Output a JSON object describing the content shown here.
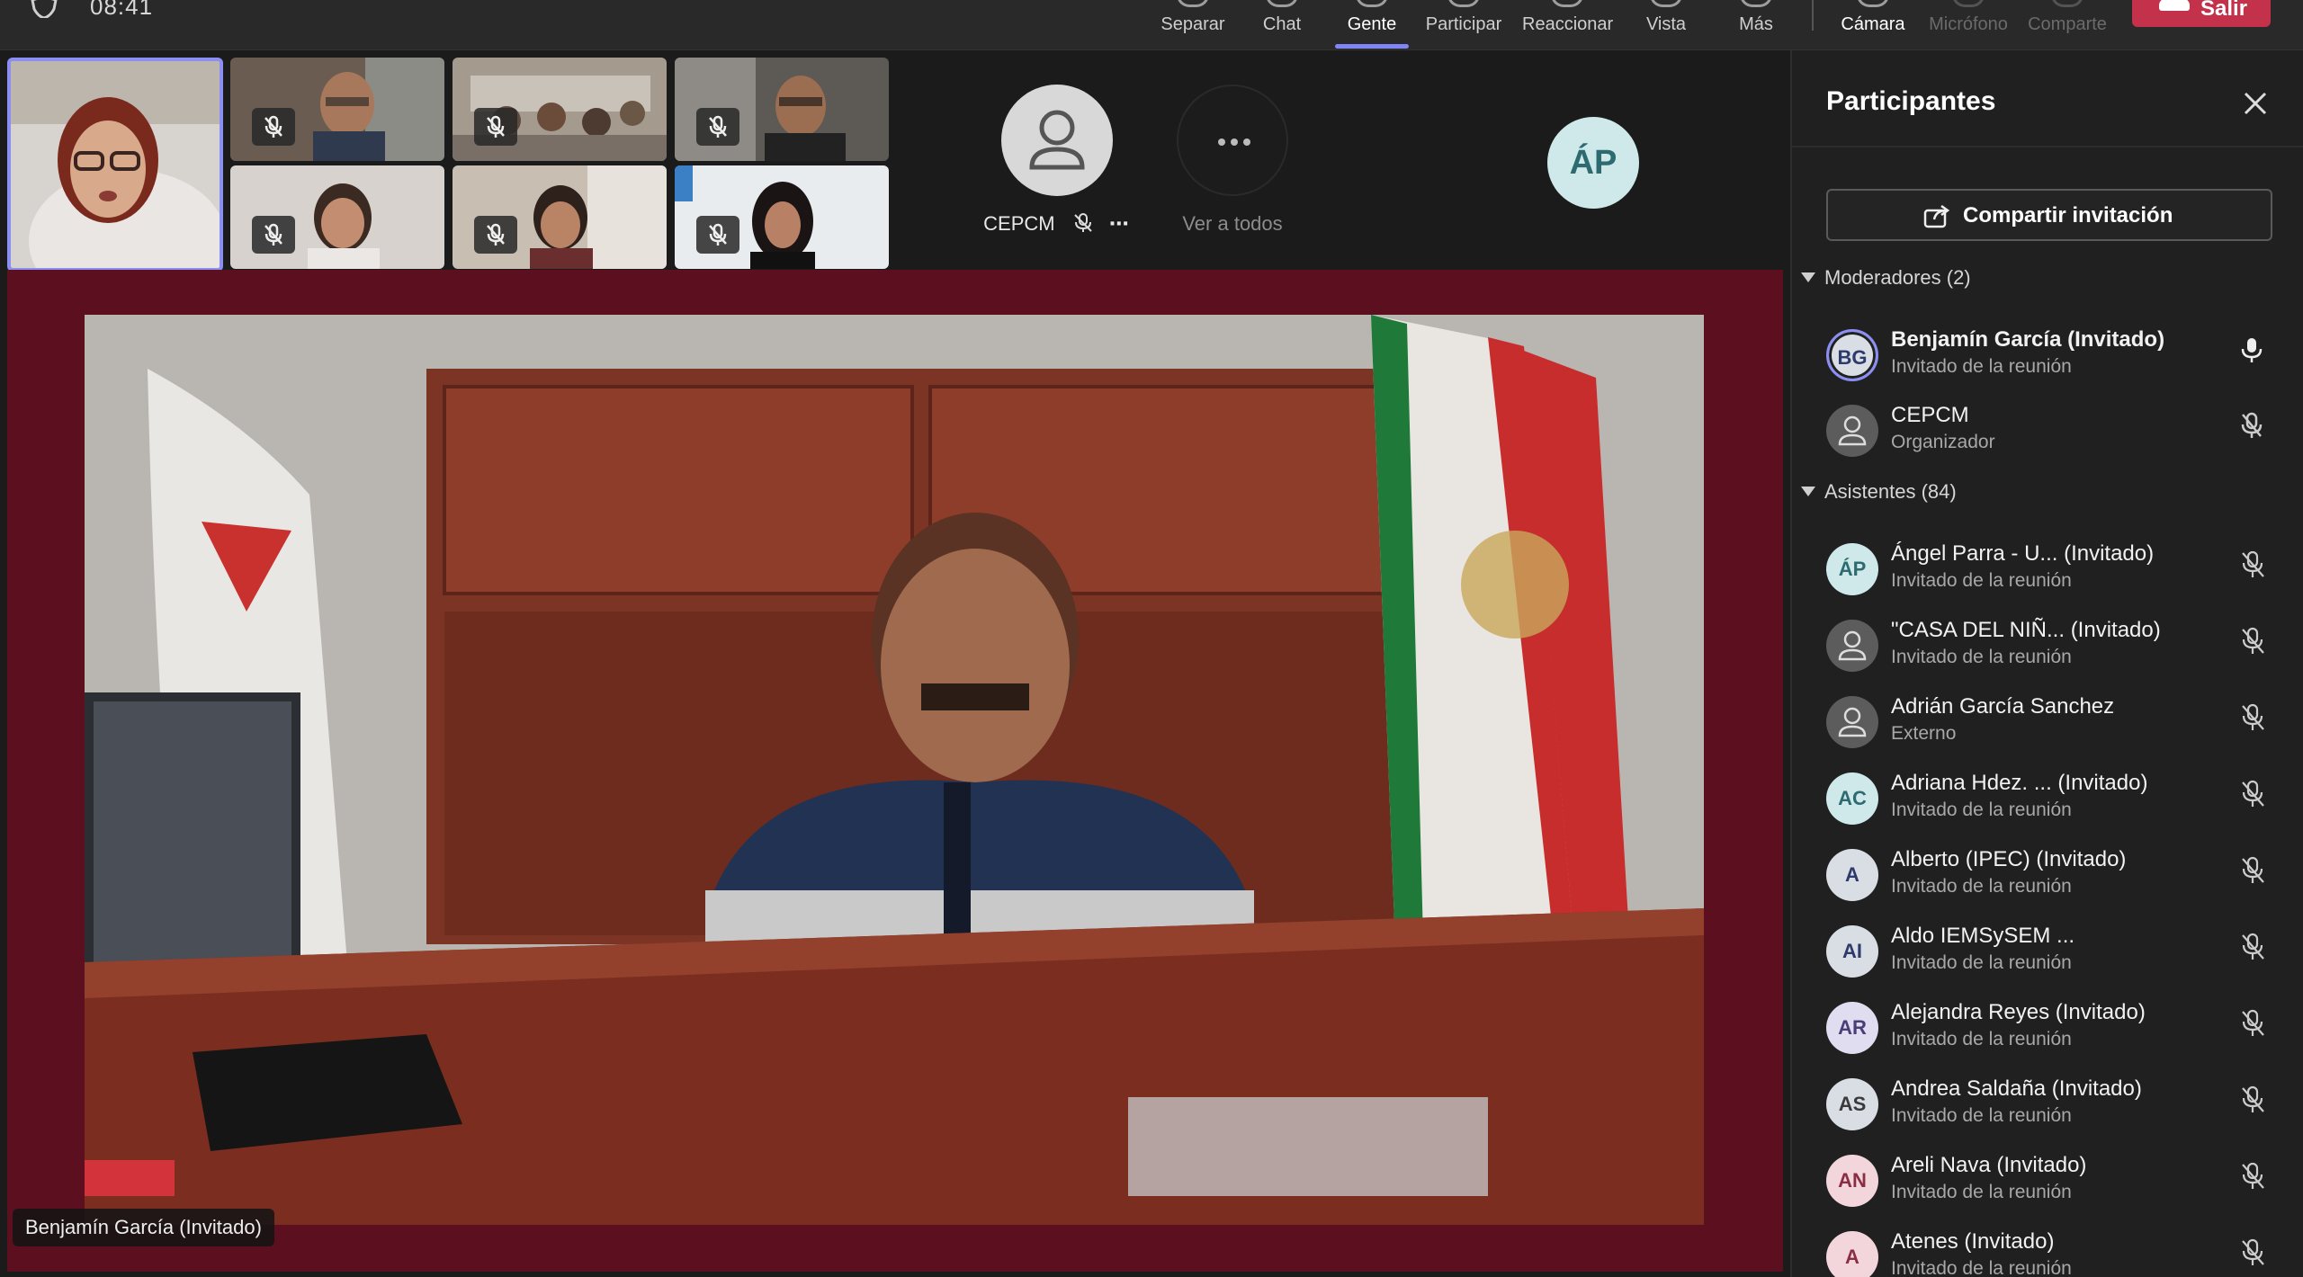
{
  "status": {
    "time": "08:41"
  },
  "toolbar": {
    "items": [
      {
        "label": "Separar",
        "icon": "split-icon",
        "state": "normal"
      },
      {
        "label": "Chat",
        "icon": "chat-icon",
        "state": "normal"
      },
      {
        "label": "Gente",
        "icon": "people-icon",
        "state": "active"
      },
      {
        "label": "Participar",
        "icon": "raise-hand-icon",
        "state": "normal"
      },
      {
        "label": "Reaccionar",
        "icon": "react-icon",
        "state": "normal"
      },
      {
        "label": "Vista",
        "icon": "view-icon",
        "state": "normal"
      },
      {
        "label": "Más",
        "icon": "more-icon",
        "state": "normal"
      },
      {
        "label": "Cámara",
        "icon": "camera-icon",
        "state": "active"
      },
      {
        "label": "Micrófono",
        "icon": "microphone-icon",
        "state": "disabled"
      },
      {
        "label": "Comparte",
        "icon": "share-screen-icon",
        "state": "disabled"
      }
    ],
    "leave_label": "Salir"
  },
  "stage": {
    "tiles": [
      {
        "label": "CEPCM",
        "avatar": "person-icon",
        "muted": true
      },
      {
        "label": "Ver a todos",
        "avatar": "ellipsis-icon"
      }
    ],
    "floating_avatar": "ÁP",
    "speaker_name": "Benjamín García (Invitado)"
  },
  "panel": {
    "title": "Participantes",
    "share_label": "Compartir invitación",
    "moderators_label": "Moderadores (2)",
    "moderators": [
      {
        "initials": "BG",
        "name": "Benjamín García (Invitado)",
        "role": "Invitado de la reunión",
        "mic": "on"
      },
      {
        "initials": "",
        "name": "CEPCM",
        "role": "Organizador",
        "mic": "muted"
      }
    ],
    "attendees_label": "Asistentes (84)",
    "attendees": [
      {
        "initials": "ÁP",
        "name": "Ángel Parra - U... (Invitado)",
        "role": "Invitado de la reunión"
      },
      {
        "initials": "",
        "name": "\"CASA DEL NIÑ... (Invitado)",
        "role": "Invitado de la reunión"
      },
      {
        "initials": "",
        "name": "Adrián García Sanchez",
        "role": "Externo"
      },
      {
        "initials": "AC",
        "name": "Adriana Hdez. ... (Invitado)",
        "role": "Invitado de la reunión"
      },
      {
        "initials": "A",
        "name": "Alberto (IPEC) (Invitado)",
        "role": "Invitado de la reunión"
      },
      {
        "initials": "AI",
        "name": "Aldo IEMSySEM ...",
        "role": "Invitado de la reunión"
      },
      {
        "initials": "AR",
        "name": "Alejandra Reyes (Invitado)",
        "role": "Invitado de la reunión"
      },
      {
        "initials": "AS",
        "name": "Andrea Saldaña (Invitado)",
        "role": "Invitado de la reunión"
      },
      {
        "initials": "AN",
        "name": "Areli Nava (Invitado)",
        "role": "Invitado de la reunión"
      },
      {
        "initials": "A",
        "name": "Atenes (Invitado)",
        "role": "Invitado de la reunión"
      }
    ]
  },
  "colors": {
    "accent": "#7f85f5",
    "leave": "#c4314b",
    "stage_frame": "#5b0f1f",
    "avatar_teal": "#cfe9ea",
    "avatar_pink": "#f3d6dc",
    "avatar_lilac": "#e1ddf0",
    "avatar_grey": "#d9dde4"
  }
}
